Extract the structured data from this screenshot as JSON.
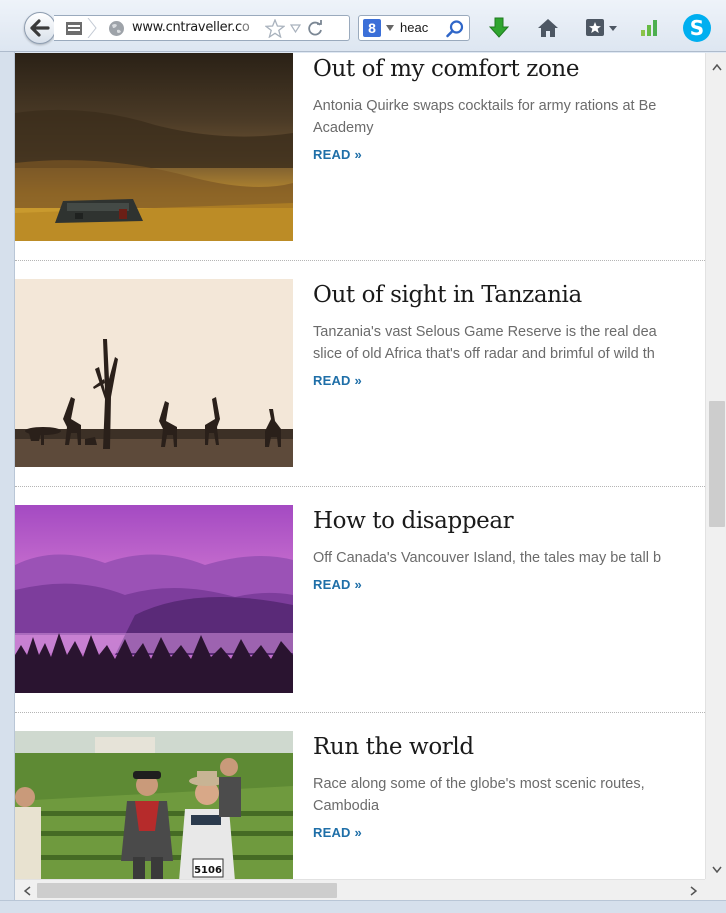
{
  "browser": {
    "url_bold": "www.cntraveller.c",
    "url_tail": "o",
    "search_text": "heac",
    "colors": {
      "accent_link": "#1f6fa8",
      "download_arrow": "#2fa52f",
      "skype": "#00aff0",
      "signal": "#4caf50"
    },
    "icons": [
      "back-arrow-icon",
      "site-grid-icon",
      "globe-icon",
      "bookmark-star-icon",
      "dropmarker-icon",
      "reload-icon",
      "google-logo-icon",
      "search-icon",
      "download-icon",
      "home-icon",
      "bookmarks-menu-icon",
      "signal-icon",
      "skype-icon"
    ]
  },
  "articles": [
    {
      "title": "Out of my comfort zone",
      "summary_lines": [
        "Antonia Quirke swaps cocktails for army rations at Be",
        "Academy"
      ],
      "read_label": "READ »",
      "image": "army tent on savanna at sunset"
    },
    {
      "title": "Out of sight in Tanzania",
      "summary_lines": [
        "Tanzania's vast Selous Game Reserve is the real dea",
        "slice of old Africa that's off radar and brimful of wild th"
      ],
      "read_label": "READ »",
      "image": "giraffe silhouettes with dead tree"
    },
    {
      "title": "How to disappear",
      "summary_lines": [
        "Off Canada's Vancouver Island, the tales may be tall b"
      ],
      "read_label": "READ »",
      "image": "purple mountains over lake and pine trees"
    },
    {
      "title": "Run the world",
      "summary_lines": [
        "Race along some of the globe's most scenic routes,",
        "Cambodia"
      ],
      "read_label": "READ »",
      "image": "runners in costume racing through a vineyard",
      "bib_number": "5106"
    }
  ]
}
